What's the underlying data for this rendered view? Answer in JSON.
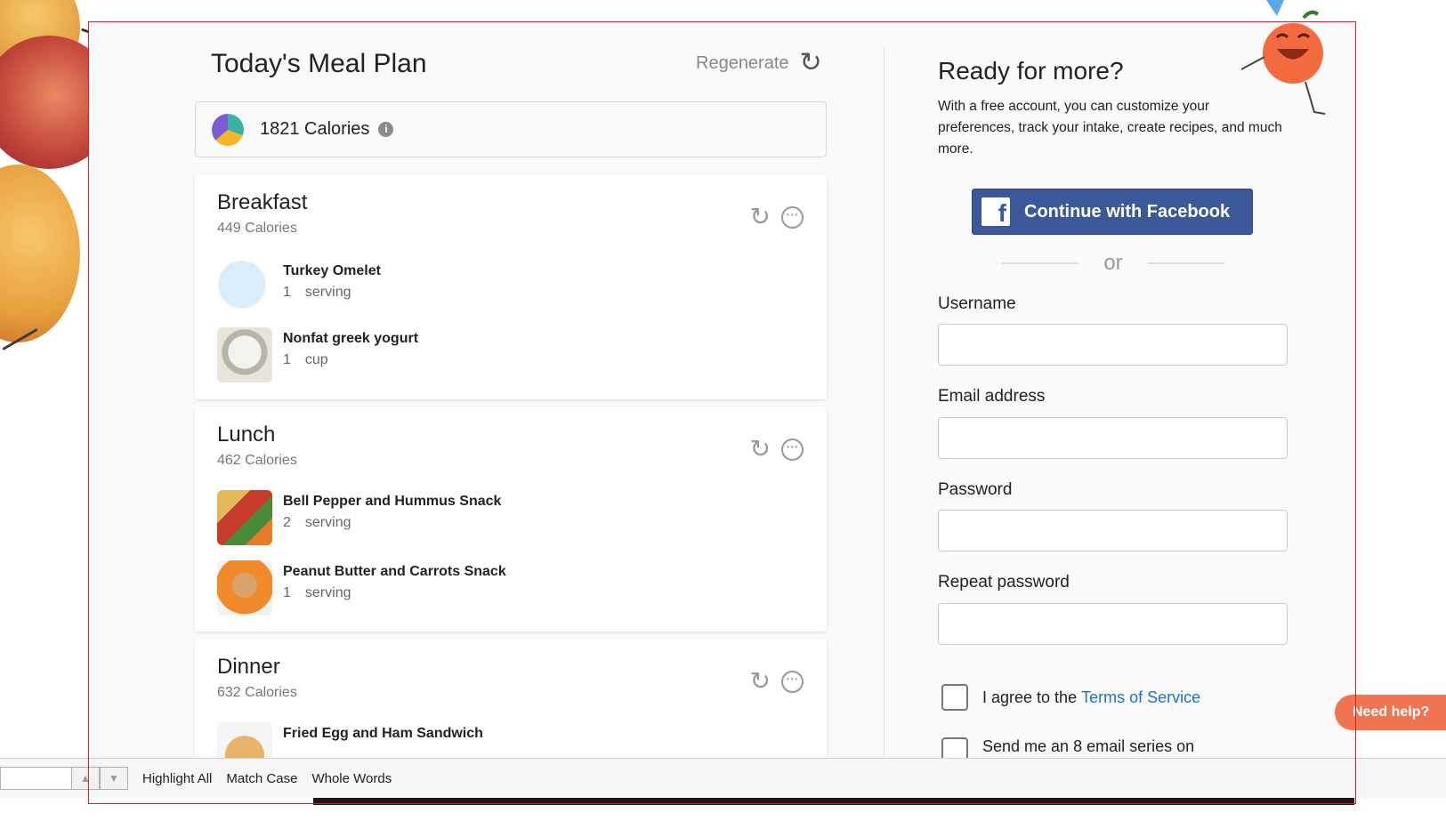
{
  "meal_plan": {
    "title": "Today's Meal Plan",
    "regenerate_label": "Regenerate",
    "total_calories": "1821 Calories",
    "meals": [
      {
        "name": "Breakfast",
        "calories": "449 Calories",
        "foods": [
          {
            "name": "Turkey Omelet",
            "qty": "1",
            "unit": "serving",
            "icon": "egg-thumbnail"
          },
          {
            "name": "Nonfat greek yogurt",
            "qty": "1",
            "unit": "cup",
            "icon": "yogurt-thumbnail"
          }
        ]
      },
      {
        "name": "Lunch",
        "calories": "462 Calories",
        "foods": [
          {
            "name": "Bell Pepper and Hummus Snack",
            "qty": "2",
            "unit": "serving",
            "icon": "pepper-hummus-thumbnail"
          },
          {
            "name": "Peanut Butter and Carrots Snack",
            "qty": "1",
            "unit": "serving",
            "icon": "carrots-thumbnail"
          }
        ]
      },
      {
        "name": "Dinner",
        "calories": "632 Calories",
        "foods": [
          {
            "name": "Fried Egg and Ham Sandwich",
            "qty": "",
            "unit": "",
            "icon": "sandwich-thumbnail"
          }
        ]
      }
    ]
  },
  "signup": {
    "title": "Ready for more?",
    "description": "With a free account, you can customize your preferences, track your intake, create recipes, and much more.",
    "facebook_button": "Continue with Facebook",
    "or_label": "or",
    "fields": {
      "username_label": "Username",
      "email_label": "Email address",
      "password_label": "Password",
      "repeat_password_label": "Repeat password"
    },
    "agree_prefix": "I agree to the",
    "terms_link": "Terms of Service",
    "email_series_label": "Send me an 8 email series on"
  },
  "help_button": "Need help?",
  "find_bar": {
    "highlight_all": "Highlight All",
    "match_case": "Match Case",
    "whole_words": "Whole Words"
  },
  "colors": {
    "facebook_blue": "#3b5998",
    "link_blue": "#1f73c8",
    "help_orange": "#f07452",
    "frame_red": "#e31d1d"
  }
}
